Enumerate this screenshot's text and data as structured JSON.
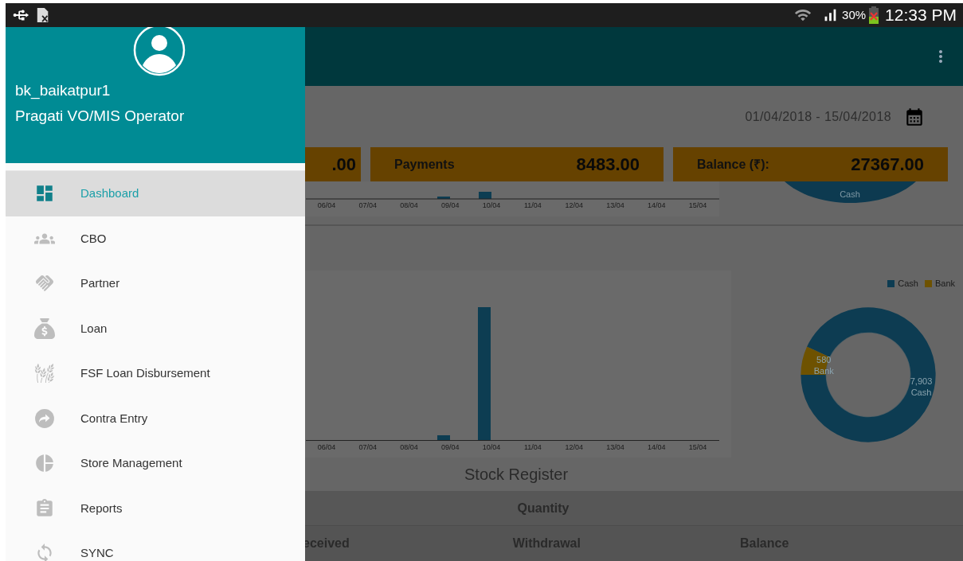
{
  "status_bar": {
    "battery": "30%",
    "time": "12:33 PM"
  },
  "drawer": {
    "username": "bk_baikatpur1",
    "role": "Pragati VO/MIS Operator",
    "items": [
      {
        "label": "Dashboard",
        "kind": "dashboard",
        "selected": true
      },
      {
        "label": "CBO",
        "kind": "group",
        "selected": false
      },
      {
        "label": "Partner",
        "kind": "handshake",
        "selected": false
      },
      {
        "label": "Loan",
        "kind": "moneybag",
        "selected": false
      },
      {
        "label": "FSF Loan Disbursement",
        "kind": "wheat",
        "selected": false
      },
      {
        "label": "Contra Entry",
        "kind": "forward",
        "selected": false
      },
      {
        "label": "Store Management",
        "kind": "pie",
        "selected": false
      },
      {
        "label": "Reports",
        "kind": "clipboard",
        "selected": false
      },
      {
        "label": "SYNC",
        "kind": "sync",
        "selected": false
      }
    ]
  },
  "dashboard": {
    "date_range": "01/04/2018 - 15/04/2018",
    "cards": [
      {
        "value": ".00"
      },
      {
        "label": "Payments",
        "value": "8483.00"
      },
      {
        "label": "Balance (₹):",
        "value": "27367.00"
      }
    ],
    "top_chart": {
      "x_labels": [
        "06/04",
        "07/04",
        "08/04",
        "09/04",
        "10/04",
        "11/04",
        "12/04",
        "13/04",
        "14/04",
        "15/04"
      ],
      "donut_label": "Cash"
    },
    "bottom_chart": {
      "x_labels": [
        "06/04",
        "07/04",
        "08/04",
        "09/04",
        "10/04",
        "11/04",
        "12/04",
        "13/04",
        "14/04",
        "15/04"
      ]
    },
    "legend": [
      {
        "label": "Cash",
        "color": "#0d3c52"
      },
      {
        "label": "Bank",
        "color": "#6e5200"
      }
    ],
    "cash_bank_donut": {
      "chart_data": {
        "type": "donut",
        "categories": [
          "Cash",
          "Bank"
        ],
        "values": [
          7903,
          580
        ],
        "value_labels": [
          "7,903",
          "580"
        ]
      }
    },
    "stock_register": {
      "title": "Stock Register",
      "group_header": "Quantity",
      "columns": [
        "eceived",
        "Withdrawal",
        "Balance"
      ]
    }
  }
}
